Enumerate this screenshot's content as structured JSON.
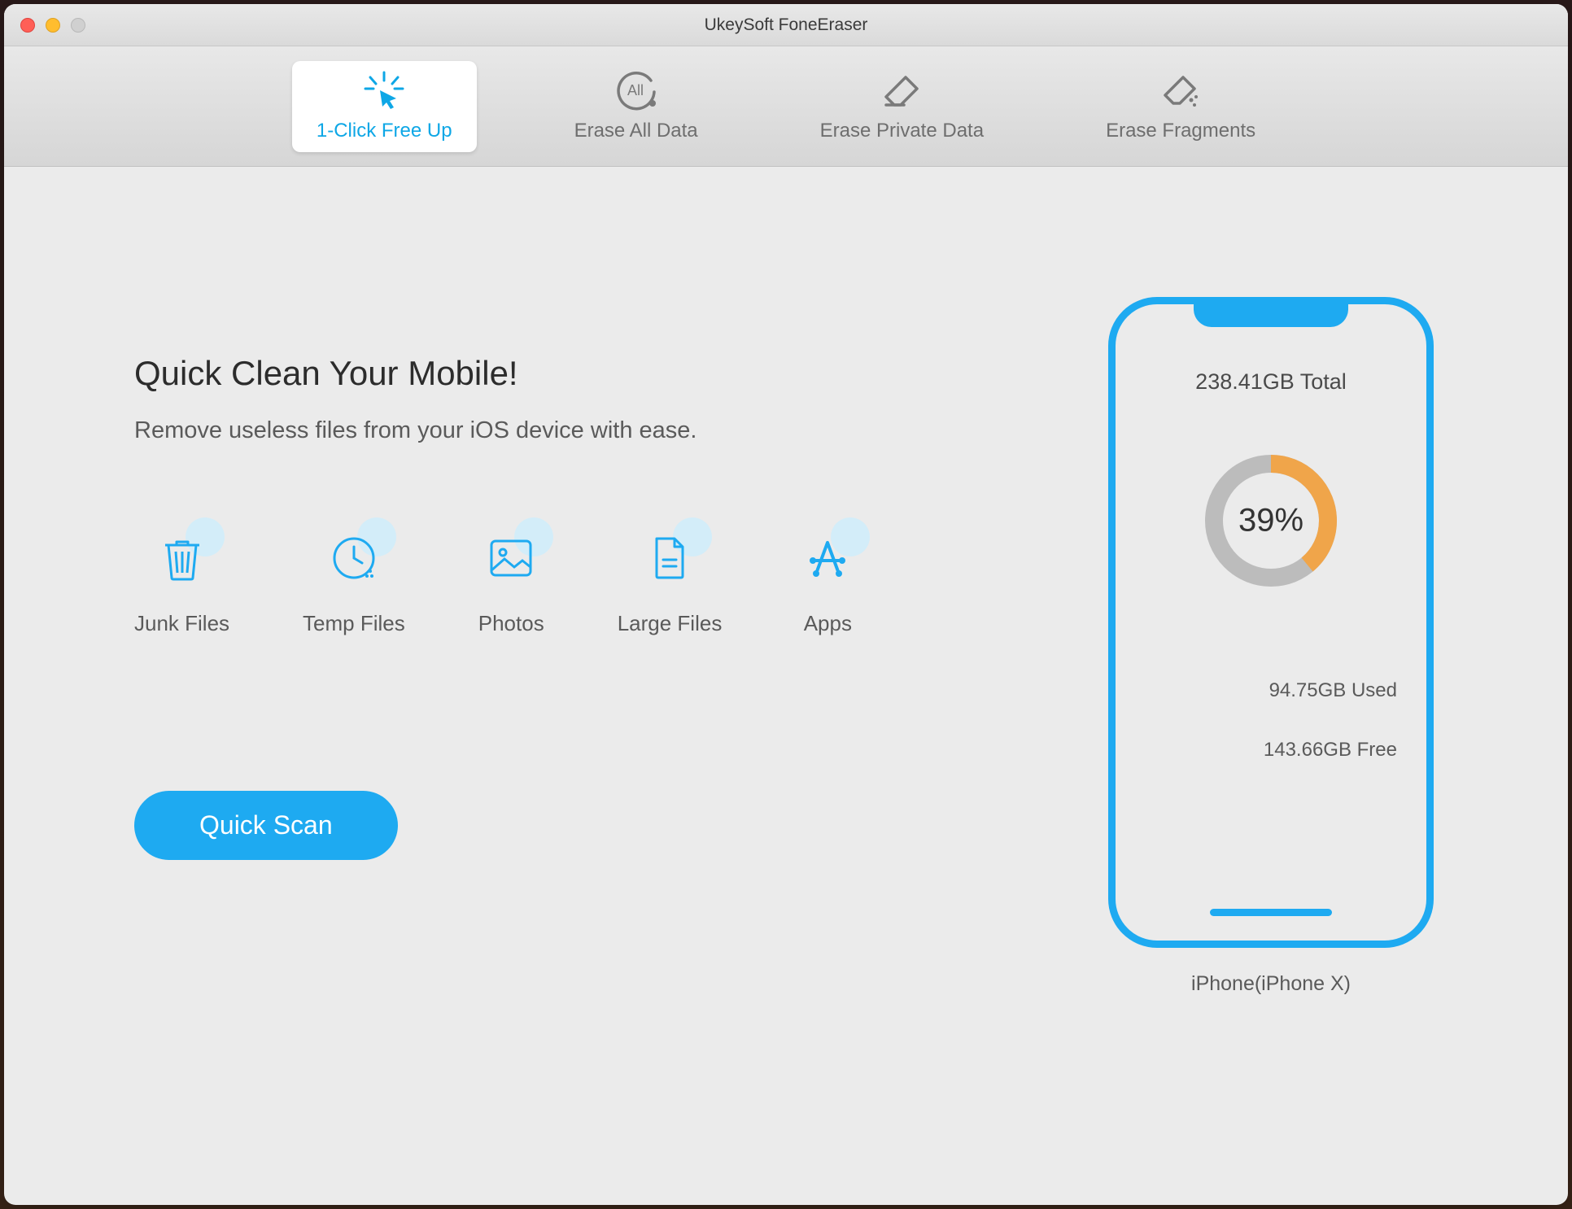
{
  "app": {
    "title": "UkeySoft FoneEraser"
  },
  "tabs": [
    {
      "label": "1-Click Free Up"
    },
    {
      "label": "Erase All Data"
    },
    {
      "label": "Erase Private Data"
    },
    {
      "label": "Erase Fragments"
    }
  ],
  "main": {
    "heading": "Quick Clean Your Mobile!",
    "subheading": "Remove useless files from your iOS device with ease.",
    "scan_button": "Quick Scan"
  },
  "categories": [
    {
      "label": "Junk Files"
    },
    {
      "label": "Temp Files"
    },
    {
      "label": "Photos"
    },
    {
      "label": "Large Files"
    },
    {
      "label": "Apps"
    }
  ],
  "device": {
    "total": "238.41GB Total",
    "used_percent": "39%",
    "used_percent_value": 39,
    "used": "94.75GB Used",
    "free": "143.66GB Free",
    "name": "iPhone(iPhone X)"
  },
  "chart_data": {
    "type": "pie",
    "title": "Storage Usage",
    "series": [
      {
        "name": "Used",
        "value": 94.75,
        "unit": "GB",
        "percent": 39
      },
      {
        "name": "Free",
        "value": 143.66,
        "unit": "GB",
        "percent": 61
      }
    ],
    "total": 238.41,
    "total_unit": "GB"
  }
}
